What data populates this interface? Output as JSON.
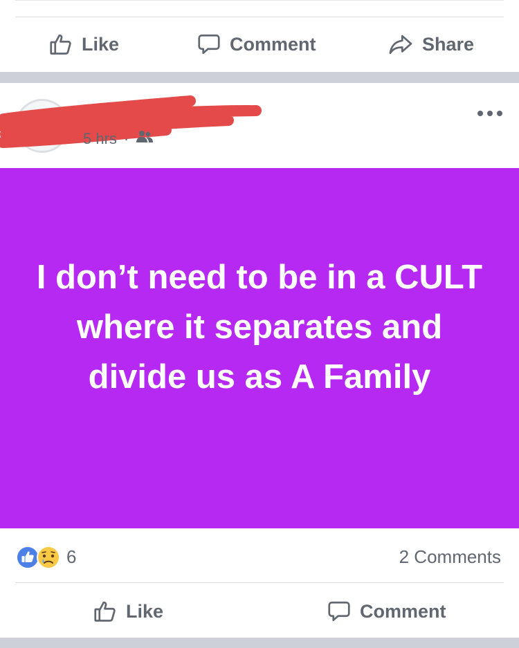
{
  "top_actions": {
    "like": "Like",
    "comment": "Comment",
    "share": "Share"
  },
  "post": {
    "time": "5 hrs",
    "text": "I don’t need to be in a CULT where it separates and divide us as A Family",
    "reaction_count": "6",
    "comments_count": "2 Comments"
  },
  "bottom_actions": {
    "like": "Like",
    "comment": "Comment"
  },
  "colors": {
    "post_background": "#b629f2",
    "like_blue": "#4d80e6",
    "redaction_red": "#e44a4a"
  }
}
